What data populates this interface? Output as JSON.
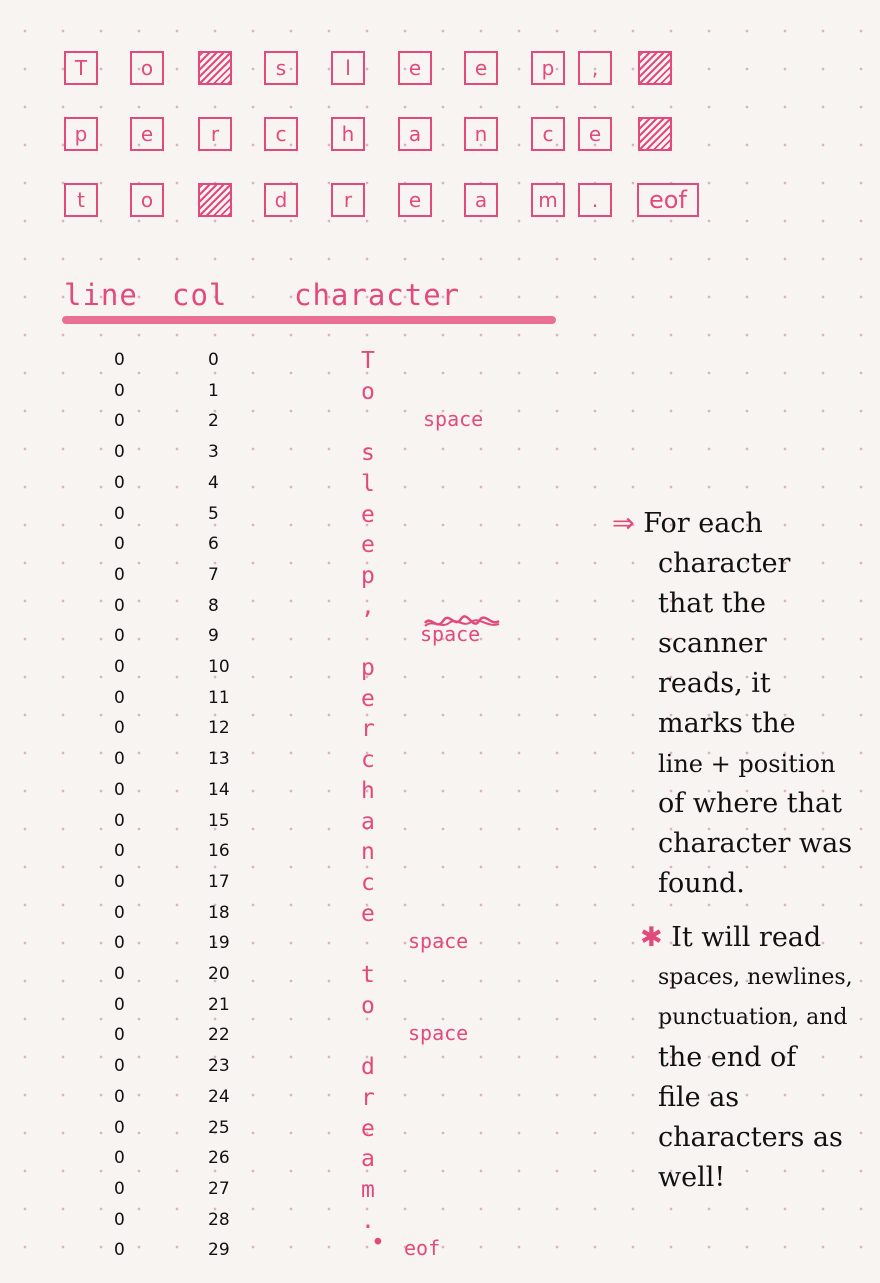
{
  "box_rows": [
    [
      "T",
      "o",
      null,
      "s",
      "l",
      "e",
      "e",
      "p",
      ",",
      null
    ],
    [
      "p",
      "e",
      "r",
      "c",
      "h",
      "a",
      "n",
      "c",
      "e",
      null
    ],
    [
      "t",
      "o",
      null,
      "d",
      "r",
      "e",
      "a",
      "m",
      ".",
      "eof"
    ]
  ],
  "table": {
    "headers": {
      "line": "line",
      "col": "col",
      "character": "character"
    },
    "rows": [
      {
        "line": "0",
        "col": "0",
        "char": "T",
        "note": ""
      },
      {
        "line": "0",
        "col": "1",
        "char": "o",
        "note": ""
      },
      {
        "line": "0",
        "col": "2",
        "char": "",
        "note": "space"
      },
      {
        "line": "0",
        "col": "3",
        "char": "s",
        "note": ""
      },
      {
        "line": "0",
        "col": "4",
        "char": "l",
        "note": ""
      },
      {
        "line": "0",
        "col": "5",
        "char": "e",
        "note": ""
      },
      {
        "line": "0",
        "col": "6",
        "char": "e",
        "note": ""
      },
      {
        "line": "0",
        "col": "7",
        "char": "p",
        "note": ""
      },
      {
        "line": "0",
        "col": "8",
        "char": ",",
        "note": ""
      },
      {
        "line": "0",
        "col": "9",
        "char": "",
        "note": "space"
      },
      {
        "line": "0",
        "col": "10",
        "char": "p",
        "note": ""
      },
      {
        "line": "0",
        "col": "11",
        "char": "e",
        "note": ""
      },
      {
        "line": "0",
        "col": "12",
        "char": "r",
        "note": ""
      },
      {
        "line": "0",
        "col": "13",
        "char": "c",
        "note": ""
      },
      {
        "line": "0",
        "col": "14",
        "char": "h",
        "note": ""
      },
      {
        "line": "0",
        "col": "15",
        "char": "a",
        "note": ""
      },
      {
        "line": "0",
        "col": "16",
        "char": "n",
        "note": ""
      },
      {
        "line": "0",
        "col": "17",
        "char": "c",
        "note": ""
      },
      {
        "line": "0",
        "col": "18",
        "char": "e",
        "note": ""
      },
      {
        "line": "0",
        "col": "19",
        "char": "",
        "note": "space"
      },
      {
        "line": "0",
        "col": "20",
        "char": "t",
        "note": ""
      },
      {
        "line": "0",
        "col": "21",
        "char": "o",
        "note": ""
      },
      {
        "line": "0",
        "col": "22",
        "char": "",
        "note": "space"
      },
      {
        "line": "0",
        "col": "23",
        "char": "d",
        "note": ""
      },
      {
        "line": "0",
        "col": "24",
        "char": "r",
        "note": ""
      },
      {
        "line": "0",
        "col": "25",
        "char": "e",
        "note": ""
      },
      {
        "line": "0",
        "col": "26",
        "char": "a",
        "note": ""
      },
      {
        "line": "0",
        "col": "27",
        "char": "m",
        "note": ""
      },
      {
        "line": "0",
        "col": "28",
        "char": ".",
        "note": ""
      },
      {
        "line": "0",
        "col": "29",
        "char": "",
        "note": "eof"
      }
    ]
  },
  "side_note": {
    "arrow": "⇒",
    "lines": [
      "For each",
      "character",
      "that the",
      "scanner",
      "reads, it",
      "marks the",
      "line + position",
      "of where that",
      "character was",
      "found."
    ],
    "star": "✱",
    "star_lines": [
      "It will read",
      "spaces, newlines,",
      "punctuation, and",
      "the end of",
      "file as",
      "characters as",
      "well!"
    ]
  },
  "colors": {
    "ink_pink": "#e24a7c",
    "ink_black": "#111111",
    "paper": "#f8f4f1",
    "dots": "#d9b3bf"
  }
}
